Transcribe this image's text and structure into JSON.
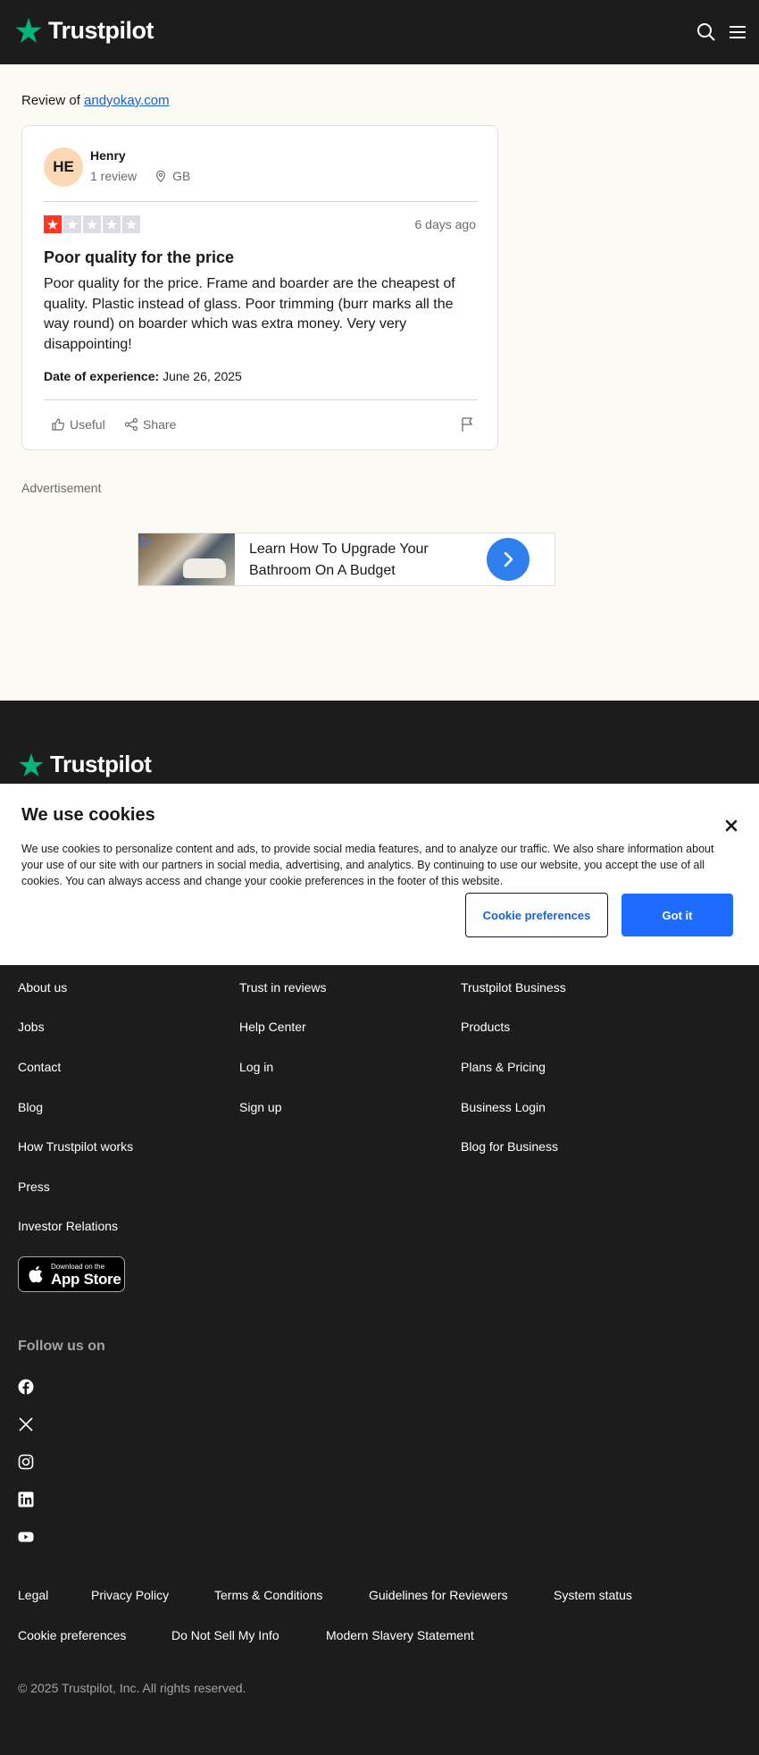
{
  "header": {
    "brand": "Trustpilot",
    "icons": [
      "search-icon",
      "menu-icon"
    ]
  },
  "review": {
    "review_of_label": "Review of",
    "company": "andyokay.com",
    "user": {
      "initials": "HE",
      "name": "Henry",
      "reviews_count": "1 review",
      "country": "GB"
    },
    "rating": 1,
    "rating_max": 5,
    "date": "6 days ago",
    "title": "Poor quality for the price",
    "body": "Poor quality for the price. Frame and boarder are the cheapest of quality. Plastic instead of glass. Poor trimming (burr marks all the way round) on boarder which was extra money. Very very disappointing!",
    "experience_label": "Date of experience:",
    "experience_date": "June 26, 2025",
    "actions": {
      "useful": "Useful",
      "share": "Share"
    }
  },
  "ad": {
    "label": "Advertisement",
    "text": "Learn How To Upgrade Your Bathroom On A Budget"
  },
  "footer": {
    "brand": "Trustpilot",
    "col1": [
      "About us",
      "Jobs",
      "Contact",
      "Blog",
      "How Trustpilot works",
      "Press",
      "Investor Relations"
    ],
    "col2": [
      "Trust in reviews",
      "Help Center",
      "Log in",
      "Sign up"
    ],
    "col3": [
      "Trustpilot Business",
      "Products",
      "Plans & Pricing",
      "Business Login",
      "Blog for Business"
    ],
    "appstore_small": "Download on the",
    "appstore_big": "App Store",
    "follow": "Follow us on",
    "social_icons": [
      "facebook-icon",
      "x-icon",
      "instagram-icon",
      "linkedin-icon",
      "youtube-icon"
    ],
    "legal_row1": [
      "Legal",
      "Privacy Policy",
      "Terms & Conditions",
      "Guidelines for Reviewers",
      "System status"
    ],
    "legal_row2": [
      "Cookie preferences",
      "Do Not Sell My Info",
      "Modern Slavery Statement"
    ],
    "copyright": "© 2025 Trustpilot, Inc. All rights reserved."
  },
  "cookie": {
    "title": "We use cookies",
    "text": "We use cookies to personalize content and ads, to provide social media features, and to analyze our traffic. We also share information about your use of our site with our partners in social media, advertising, and analytics. By continuing to use our website, you accept the use of all cookies. You can always access and change your cookie preferences in the footer of this website.",
    "preferences_button": "Cookie preferences",
    "accept_button": "Got it"
  },
  "colors": {
    "brand_green": "#00b67a",
    "star_red": "#ff3722",
    "link_blue": "#1c5fd1",
    "primary_button": "#1e6bff",
    "cream_bg": "#fbfaf3",
    "dark_bg": "#1c1c1c"
  }
}
